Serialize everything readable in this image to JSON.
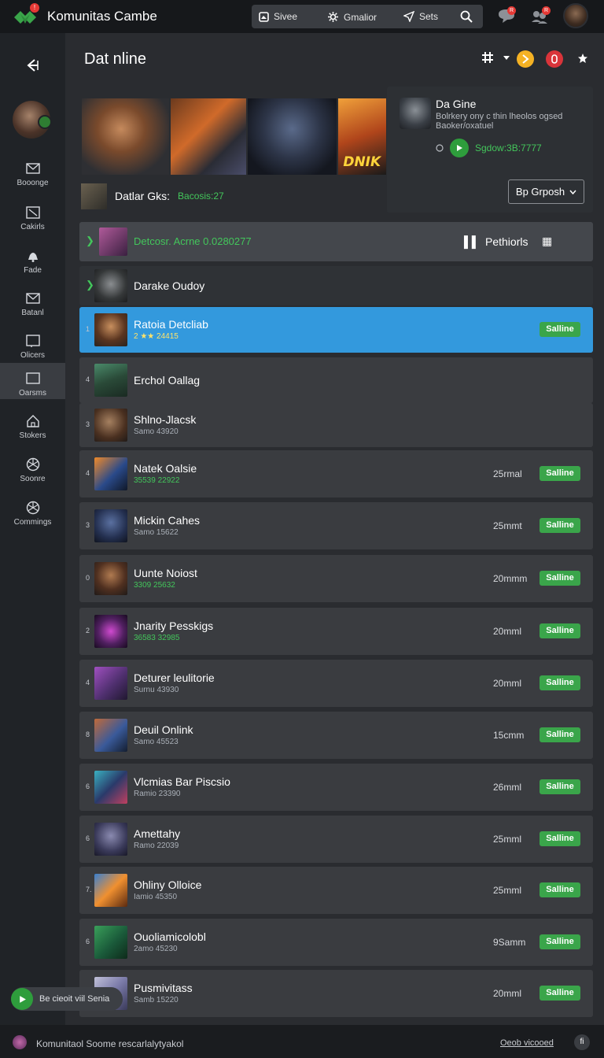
{
  "app": {
    "title": "Komunitas Cambe",
    "logo_badge": "!"
  },
  "topnav": {
    "items": [
      {
        "label": "Sivee",
        "icon": "image-icon"
      },
      {
        "label": "Gmalior",
        "icon": "gear-icon"
      },
      {
        "label": "Sets",
        "icon": "send-icon"
      }
    ],
    "search_icon": "search-icon",
    "notif_badge_1": "R",
    "notif_badge_2": "R"
  },
  "sidebar": {
    "items": [
      {
        "label": "Booonge",
        "icon": "mail-icon"
      },
      {
        "label": "Cakirls",
        "icon": "square-slash-icon"
      },
      {
        "label": "Fade",
        "icon": "bell-icon"
      },
      {
        "label": "Batanl",
        "icon": "mail-icon"
      },
      {
        "label": "Olicers",
        "icon": "window-icon"
      },
      {
        "label": "Oarsms",
        "icon": "window-icon",
        "active": true
      },
      {
        "label": "Stokers",
        "icon": "home-icon"
      },
      {
        "label": "Soonre",
        "icon": "aperture-icon"
      },
      {
        "label": "Commings",
        "icon": "aperture-icon"
      }
    ]
  },
  "main": {
    "title": "Dat nline",
    "banner_text": "DNIK",
    "details": {
      "label": "Datlar Gks:",
      "value": "Bacosis:27"
    }
  },
  "feature": {
    "title": "Da Gine",
    "description": "Bolrkery ony c thin lheolos ogsed Baoker/oxatuel",
    "code": "Sgdow:3B:7777",
    "group_button": "Bp Grposh"
  },
  "rows": [
    {
      "idx": "",
      "name": "Detcosr. Acrne 0.0280277",
      "sub": "",
      "time": "",
      "status": "",
      "type": "header",
      "right_label": "Pethiorls"
    },
    {
      "idx": "",
      "name": "Darake Oudoy",
      "sub": "",
      "time": "",
      "status": "",
      "type": "dark"
    },
    {
      "idx": "1",
      "name": "Ratoia Detcliab",
      "sub": "2 ★★ 24415",
      "time": "",
      "status": "Salline",
      "type": "highlight"
    },
    {
      "idx": "4",
      "name": "Erchol Oallag",
      "sub": "",
      "time": "",
      "status": "",
      "type": "normal"
    },
    {
      "idx": "3",
      "name": "Shlno-Jlacsk",
      "sub": "Samo 43920",
      "time": "",
      "status": "",
      "type": "normal"
    },
    {
      "idx": "4",
      "name": "Natek Oalsie",
      "sub": "35539 22922",
      "sub_green": true,
      "time": "25rmal",
      "status": "Salline",
      "type": "normal"
    },
    {
      "idx": "3",
      "name": "Mickin Cahes",
      "sub": "Samo 15622",
      "time": "25mmt",
      "status": "Salline",
      "type": "normal"
    },
    {
      "idx": "0",
      "name": "Uunte Noiost",
      "sub": "3309 25632",
      "sub_green": true,
      "time": "20mmm",
      "status": "Salline",
      "type": "normal"
    },
    {
      "idx": "2",
      "name": "Jnarity Pesskigs",
      "sub": "36583 32985",
      "sub_green": true,
      "time": "20mml",
      "status": "Salline",
      "type": "normal"
    },
    {
      "idx": "4",
      "name": "Deturer leulitorie",
      "sub": "Surnu 43930",
      "time": "20mml",
      "status": "Salline",
      "type": "normal"
    },
    {
      "idx": "8",
      "name": "Deuil Onlink",
      "sub": "Samo 45523",
      "time": "15cmm",
      "status": "Salline",
      "type": "normal"
    },
    {
      "idx": "6",
      "name": "Vlcmias Bar Piscsio",
      "sub": "Ramio 23390",
      "time": "26mml",
      "status": "Salline",
      "type": "normal"
    },
    {
      "idx": "6",
      "name": "Amettahy",
      "sub": "Ramo 22039",
      "time": "25mml",
      "status": "Salline",
      "type": "normal"
    },
    {
      "idx": "7.",
      "name": "Ohliny Olloice",
      "sub": "Iamio 45350",
      "time": "25mml",
      "status": "Salline",
      "type": "normal"
    },
    {
      "idx": "6",
      "name": "Ouoliamicolobl",
      "sub": "2amo 45230",
      "time": "9Samm",
      "status": "Salline",
      "type": "normal"
    },
    {
      "idx": "",
      "name": "Pusmivitass",
      "sub": "Samb 15220",
      "time": "20mml",
      "status": "Salline",
      "type": "normal"
    }
  ],
  "now_playing": {
    "label": "Be cieoit viil Senia"
  },
  "footer": {
    "text": "Komunitaol Soome rescarlalytyakol",
    "link": "Oeob vicooed",
    "button": "fi"
  },
  "colors": {
    "accent": "#3399dd",
    "green": "#43c65b",
    "badge": "#e53935"
  }
}
